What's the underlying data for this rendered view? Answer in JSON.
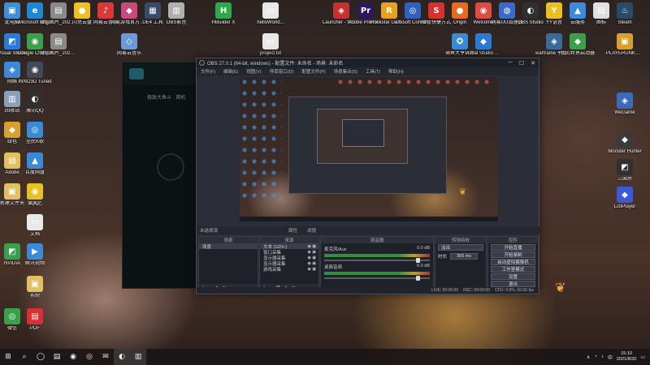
{
  "desktop": {
    "icons": [
      {
        "label": "此电脑",
        "glyph": "▣",
        "color": "#3d8fd6"
      },
      {
        "label": "Microsoft Edge",
        "glyph": "e",
        "color": "#1f86d1"
      },
      {
        "label": "微信图片_2021073...",
        "glyph": "▤",
        "color": "#8a8a8a"
      },
      {
        "label": "闪兑云盘",
        "glyph": "●",
        "color": "#f0c020"
      },
      {
        "label": "网易云音乐",
        "glyph": "♪",
        "color": "#d83a3a"
      },
      {
        "label": "网易游戏官方工具",
        "glyph": "◆",
        "color": "#c84a7a"
      },
      {
        "label": "UE4 工具",
        "glyph": "▦",
        "color": "#3a4a6a"
      },
      {
        "label": "OBS影音",
        "glyph": "▥",
        "color": "#b0b0b0"
      },
      {
        "label": "HBuilder X",
        "glyph": "H",
        "color": "#2eaa4a"
      },
      {
        "label": "helloWorld...",
        "glyph": "▭",
        "color": "#e8e8e8"
      },
      {
        "label": "Launcher - 快捷方式",
        "glyph": "◈",
        "color": "#c83030"
      },
      {
        "label": "Adobe Premie...",
        "glyph": "Pr",
        "color": "#2a1a5a"
      },
      {
        "label": "Rockstar Games...",
        "glyph": "R",
        "color": "#e8a020"
      },
      {
        "label": "Ubisoft Connect",
        "glyph": "◎",
        "color": "#3060c0"
      },
      {
        "label": "微信快捷方式",
        "glyph": "S",
        "color": "#d83030"
      },
      {
        "label": "Origin",
        "glyph": "●",
        "color": "#e86a20"
      },
      {
        "label": "Welcome",
        "glyph": "◉",
        "color": "#e04a40"
      },
      {
        "label": "网易UU加速器",
        "glyph": "◍",
        "color": "#3a6ac8"
      },
      {
        "label": "OBS Studio",
        "glyph": "◐",
        "color": "#303030"
      },
      {
        "label": "YY语音",
        "glyph": "Y",
        "color": "#e8c020"
      },
      {
        "label": "云服务",
        "glyph": "▲",
        "color": "#3a8ae0"
      },
      {
        "label": "图标",
        "glyph": "▤",
        "color": "#e0e0e0"
      },
      {
        "label": "Steam",
        "glyph": "♨",
        "color": "#2a4a6a"
      },
      {
        "label": "Visual Studio",
        "glyph": "◩",
        "color": "#2a7ad8"
      },
      {
        "label": "Google Chrome",
        "glyph": "◉",
        "color": "#3aa04a"
      },
      {
        "label": "微信图片_2021073...",
        "glyph": "▤",
        "color": "#8a8a8a"
      },
      {
        "label": "网易云音乐",
        "glyph": "◇",
        "color": "#6a9ad8"
      },
      {
        "label": "project.txt",
        "glyph": "▭",
        "color": "#e8e8e8"
      },
      {
        "label": "捕鱼大亨文件",
        "glyph": "✪",
        "color": "#3a8ad8"
      },
      {
        "label": "Visual Studio Code",
        "glyph": "◆",
        "color": "#2a7ad8"
      },
      {
        "label": "warframe 平台快捷方式",
        "glyph": "◈",
        "color": "#3a6a9a"
      },
      {
        "label": "我的世界启动器",
        "glyph": "◆",
        "color": "#3aa04a"
      },
      {
        "label": "PLAYERUNKNOWN'S BATTLEGR...",
        "glyph": "▣",
        "color": "#d8a030"
      }
    ]
  },
  "bg_window": {
    "title": "极致大鱼斗 · 首机"
  },
  "obs": {
    "title": "OBS 27.0.1 (64-bit, windows) - 配置文件: 未命名 - 场景: 未命名",
    "menu": [
      "文件(F)",
      "编辑(E)",
      "视图(V)",
      "停靠窗口(D)",
      "配置文件(P)",
      "场景集合(S)",
      "工具(T)",
      "帮助(H)"
    ],
    "dock_headers": {
      "scenes": "场景",
      "sources": "来源",
      "mixer": "混音器",
      "transitions": "转场特效",
      "controls": "控件"
    },
    "no_source": "未选择源",
    "properties": "属性",
    "filters": "滤镜",
    "scenes": [
      "场景"
    ],
    "sources": [
      {
        "name": "文本 (GDI+)",
        "visible": true
      },
      {
        "name": "窗口采集",
        "visible": true
      },
      {
        "name": "显示器采集",
        "visible": true
      },
      {
        "name": "显示器采集",
        "visible": true
      },
      {
        "name": "游戏采集",
        "visible": true
      }
    ],
    "mixer": [
      {
        "name": "麦克风/Aux",
        "db": "0.0 dB"
      },
      {
        "name": "桌面音频",
        "db": "0.0 dB"
      }
    ],
    "transition": {
      "type": "淡出",
      "duration_label": "时长",
      "duration": "300 ms"
    },
    "controls": [
      "开始直播",
      "开始录制",
      "启动虚拟摄像机",
      "工作室模式",
      "设置",
      "退出"
    ],
    "status": {
      "drop": "LIVE: 00:00:00",
      "rec": "REC: 00:00:00",
      "cpu": "CPU: 0.8%, 60.00 fps"
    }
  },
  "taskbar": {
    "items": [
      "⊞",
      "⌕",
      "◯",
      "▤",
      "◉",
      "◎",
      "✉",
      "◐",
      "▥"
    ],
    "tray": {
      "time": "15:10",
      "date": "2021/8/20",
      "lang": "中"
    }
  }
}
